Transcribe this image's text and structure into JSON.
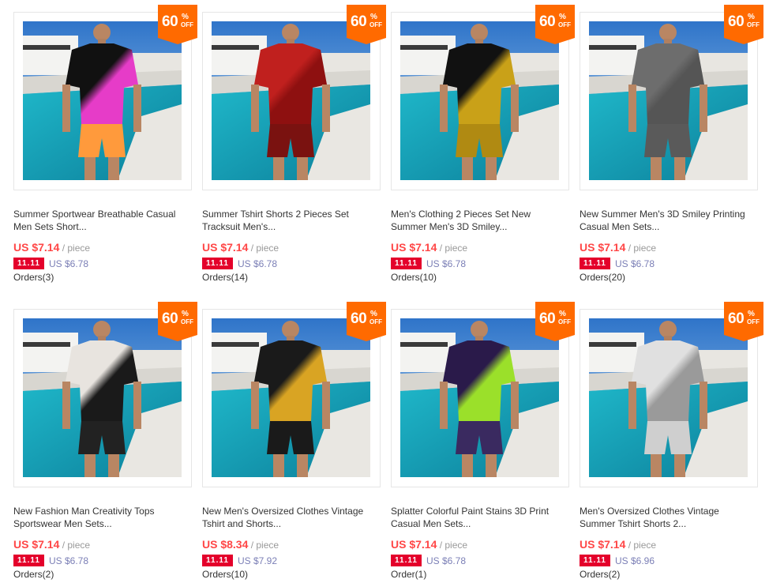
{
  "colors": {
    "price": "#ff4747",
    "badge": "#ff6a00",
    "promo": "#e4002b"
  },
  "badge": {
    "number": "60",
    "percent": "%",
    "off": "OFF"
  },
  "promo_tag": "11.11",
  "products": [
    {
      "title_line1": "Summer Sportwear Breathable Casual",
      "title_line2": "Men Sets Short...",
      "price": "US $7.14",
      "unit": "/ piece",
      "original": "US $6.78",
      "orders": "Orders(3)",
      "shirt_color": "#111111",
      "accent_color": "#e63cc8",
      "shorts_color": "#ff9a3c"
    },
    {
      "title_line1": "Summer Tshirt Shorts 2 Pieces Set",
      "title_line2": "Tracksuit Men's...",
      "price": "US $7.14",
      "unit": "/ piece",
      "original": "US $6.78",
      "orders": "Orders(14)",
      "shirt_color": "#c0201e",
      "accent_color": "#8e1010",
      "shorts_color": "#7a1210"
    },
    {
      "title_line1": "Men's Clothing 2 Pieces Set New",
      "title_line2": "Summer Men's 3D Smiley...",
      "price": "US $7.14",
      "unit": "/ piece",
      "original": "US $6.78",
      "orders": "Orders(10)",
      "shirt_color": "#111111",
      "accent_color": "#c9a118",
      "shorts_color": "#b08a12"
    },
    {
      "title_line1": "New Summer Men's 3D Smiley Printing",
      "title_line2": "Casual Men Sets...",
      "price": "US $7.14",
      "unit": "/ piece",
      "original": "US $6.78",
      "orders": "Orders(20)",
      "shirt_color": "#6d6d6d",
      "accent_color": "#555555",
      "shorts_color": "#5a5a5a"
    },
    {
      "title_line1": "New Fashion Man Creativity Tops",
      "title_line2": "Sportswear Men Sets...",
      "price": "US $7.14",
      "unit": "/ piece",
      "original": "US $6.78",
      "orders": "Orders(2)",
      "shirt_color": "#e8e4df",
      "accent_color": "#1a1a1a",
      "shorts_color": "#222222"
    },
    {
      "title_line1": "New Men's Oversized Clothes Vintage",
      "title_line2": "Tshirt and Shorts...",
      "price": "US $8.34",
      "unit": "/ piece",
      "original": "US $7.92",
      "orders": "Orders(10)",
      "shirt_color": "#1a1a1a",
      "accent_color": "#d9a423",
      "shorts_color": "#1a1a1a"
    },
    {
      "title_line1": "Splatter Colorful Paint Stains 3D Print",
      "title_line2": "Casual Men Sets...",
      "price": "US $7.14",
      "unit": "/ piece",
      "original": "US $6.78",
      "orders": "Order(1)",
      "shirt_color": "#2a1a4a",
      "accent_color": "#9be02a",
      "shorts_color": "#3a2a60"
    },
    {
      "title_line1": "Men's Oversized Clothes Vintage",
      "title_line2": "Summer Tshirt Shorts 2...",
      "price": "US $7.14",
      "unit": "/ piece",
      "original": "US $6.96",
      "orders": "Orders(2)",
      "shirt_color": "#e0e0e0",
      "accent_color": "#9a9a9a",
      "shorts_color": "#cfcfcf"
    }
  ]
}
